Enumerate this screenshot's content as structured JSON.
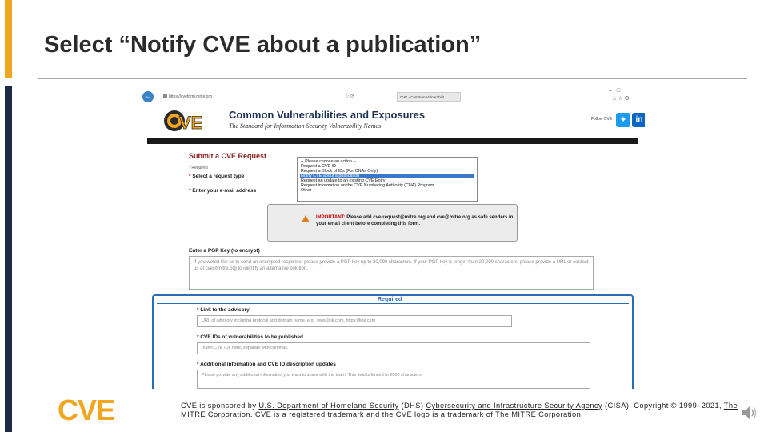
{
  "slide": {
    "title": "Select “Notify CVE about a publication”",
    "colors": {
      "accent": "#f2a51e",
      "dark_bar": "#1f2a44"
    }
  },
  "browser": {
    "address": "https://cveform.mitre.org",
    "tab_title": "CVE - Common Vulnerabilit...",
    "address_tools": "☆ ⟳"
  },
  "cve_site": {
    "header_title": "Common Vulnerabilities and Exposures",
    "header_subtitle": "The Standard for Information Security Vulnerability Names",
    "follow_label": "Follow CVE",
    "form_heading": "Submit a CVE Request",
    "required_note": "* Required",
    "select_type_label": "Select a request type",
    "email_label": "Enter your e-mail address",
    "request_options": [
      "-- Please choose an action --",
      "Request a CVE ID",
      "Request a Block of IDs (For CNAs Only)",
      "Notify CVE about a publication",
      "Request an update to an existing CVE Entry",
      "Request information on the CVE Numbering Authority (CNA) Program",
      "Other"
    ],
    "selected_option": "Notify CVE about a publication",
    "important_label": "IMPORTANT:",
    "important_text": " Please add cve-request@mitre.org and cve@mitre.org as safe senders in your email client before completing this form.",
    "pgp_label": "Enter a PGP Key (to encrypt)",
    "pgp_placeholder": "If you would like us to send an encrypted response, please provide a PGP key up to 20,000 characters. If your PGP key is longer than 20,000 characters, please provide a URL or contact us at cve@mitre.org to identify an alternative solution.",
    "required_section_title": "Required",
    "advisory_label": "Link to the advisory",
    "advisory_placeholder": "URL of advisory including protocol and domain name, e.g., www.link.com, https://link.com",
    "cve_ids_label": "CVE IDs of vulnerabilities to be published",
    "cve_ids_placeholder": "Insert CVE IDs here, separate with commas.",
    "additional_label": "Additional information and CVE ID description updates",
    "additional_placeholder": "Please provide any additional information you want to share with the team. This field is limited to 2000 characters."
  },
  "footer": {
    "prefix": "CVE is sponsored by ",
    "dhs": "U.S. Department of Homeland Security",
    "mid1": " (DHS) ",
    "cisa": "Cybersecurity and Infrastructure Security Agency",
    "mid2": " (CISA). Copyright © 1999–2021, ",
    "mitre": "The MITRE Corporation",
    "suffix": ". CVE is a registered trademark and the CVE logo is a trademark of The MITRE Corporation."
  },
  "icons": [
    "back-arrow-icon",
    "forward-arrow-icon",
    "lock-icon",
    "twitter-icon",
    "linkedin-icon",
    "warning-icon",
    "speaker-icon"
  ]
}
